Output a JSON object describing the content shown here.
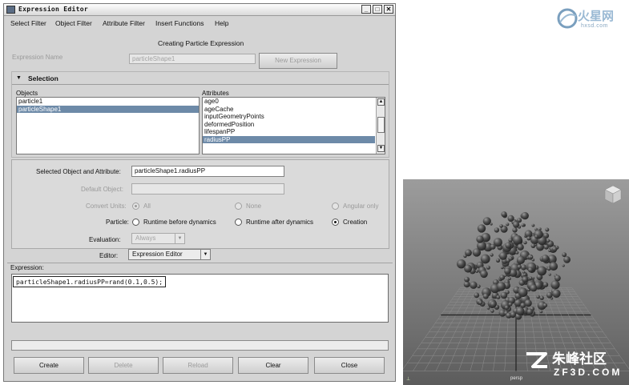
{
  "window": {
    "title": "Expression Editor",
    "controls": {
      "minimize": "_",
      "maximize": "□",
      "close": "✕"
    }
  },
  "menubar": [
    "Select Filter",
    "Object Filter",
    "Attribute Filter",
    "Insert Functions",
    "Help"
  ],
  "heading": "Creating Particle Expression",
  "expression_name": {
    "label": "Expression Name",
    "value": "particleShape1",
    "button": "New Expression"
  },
  "selection": {
    "section_label": "Selection",
    "objects_label": "Objects",
    "attributes_label": "Attributes",
    "objects": [
      "particle1",
      "particleShape1"
    ],
    "objects_selected": 1,
    "attributes": [
      "age0",
      "ageCache",
      "inputGeometryPoints",
      "deformedPosition",
      "lifespanPP",
      "radiusPP"
    ],
    "attributes_selected": 5
  },
  "properties": {
    "selected_label": "Selected Object and Attribute:",
    "selected_value": "particleShape1.radiusPP",
    "default_label": "Default Object:",
    "default_value": "",
    "convert_label": "Convert Units:",
    "convert_options": [
      "All",
      "None",
      "Angular only"
    ],
    "convert_selected": 0,
    "particle_label": "Particle:",
    "particle_options": [
      "Runtime before dynamics",
      "Runtime after dynamics",
      "Creation"
    ],
    "particle_selected": 2,
    "evaluation_label": "Evaluation:",
    "evaluation_value": "Always"
  },
  "editor": {
    "label": "Editor:",
    "value": "Expression Editor"
  },
  "expression": {
    "label": "Expression:",
    "text": "particleShape1.radiusPP=rand(0.1,0.5);"
  },
  "buttons": [
    "Create",
    "Delete",
    "Reload",
    "Clear",
    "Close"
  ],
  "viewport": {
    "corner_label": "persp"
  },
  "watermarks": {
    "top_right": "火星网",
    "top_right_sub": "hxsd.com",
    "bottom_right": "朱峰社区",
    "bottom_right_sub": "ZF3D.COM"
  },
  "colors": {
    "selection": "#6d8aa8",
    "window_bg": "#d4d4d4",
    "viewport_bg": "#8a8a8a"
  }
}
